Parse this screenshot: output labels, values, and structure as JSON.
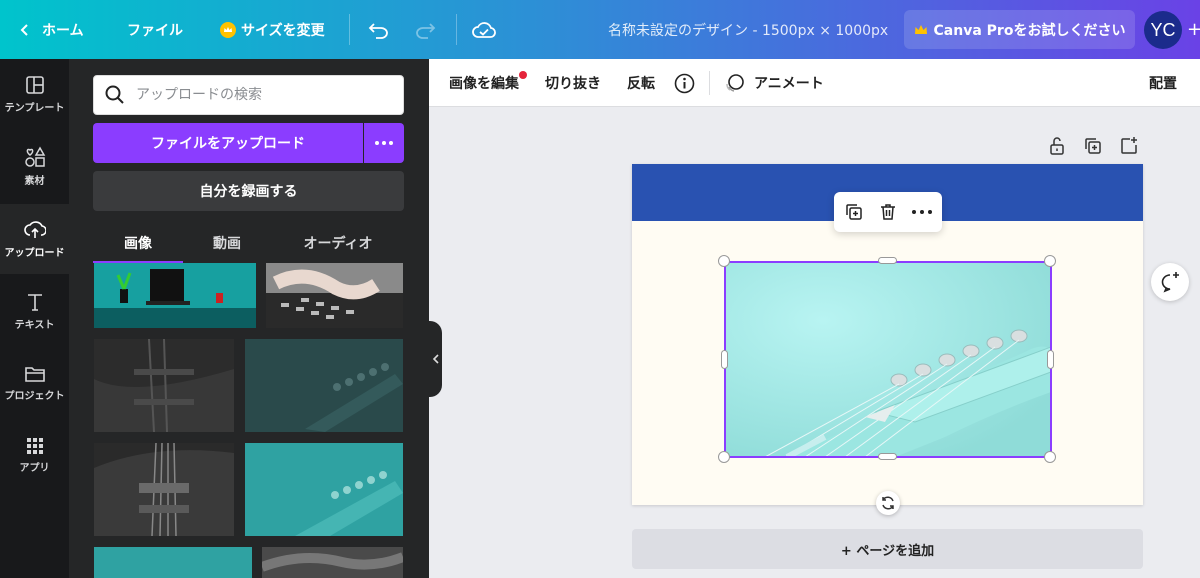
{
  "topbar": {
    "home_label": "ホーム",
    "file_label": "ファイル",
    "resize_label": "サイズを変更",
    "design_title": "名称未設定のデザイン - 1500px × 1000px",
    "pro_label": "Canva Proをお試しください",
    "avatar_initials": "YC",
    "plus_glyph": "+"
  },
  "rail": {
    "items": [
      {
        "label": "テンプレート"
      },
      {
        "label": "素材"
      },
      {
        "label": "アップロード"
      },
      {
        "label": "テキスト"
      },
      {
        "label": "プロジェクト"
      },
      {
        "label": "アプリ"
      }
    ]
  },
  "panel": {
    "search_placeholder": "アップロードの検索",
    "upload_label": "ファイルをアップロード",
    "record_label": "自分を録画する",
    "tabs": [
      {
        "label": "画像"
      },
      {
        "label": "動画"
      },
      {
        "label": "オーディオ"
      }
    ]
  },
  "toolbar": {
    "edit_image": "画像を編集",
    "crop": "切り抜き",
    "flip": "反転",
    "animate": "アニメート",
    "arrange": "配置"
  },
  "canvas": {
    "add_page_label": "+ ページを追加"
  },
  "colors": {
    "accent": "#8b3dff",
    "page_band": "#2952b1",
    "page_bg": "#fffcf3",
    "photo_bg": "#a8ecec"
  }
}
